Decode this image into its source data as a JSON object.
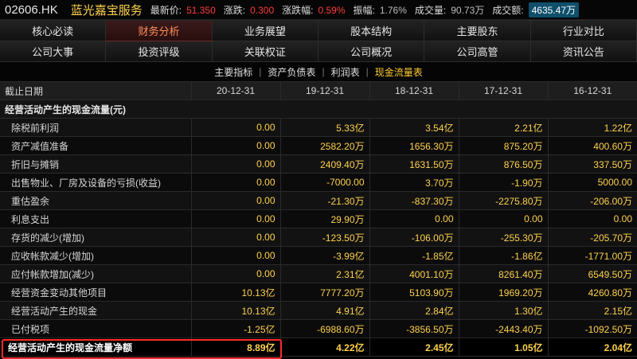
{
  "header": {
    "code": "02606.HK",
    "name": "蓝光嘉宝服务",
    "quotes": [
      {
        "label": "最新价:",
        "value": "51.350",
        "style": "red"
      },
      {
        "label": "涨跌:",
        "value": "0.300",
        "style": "red"
      },
      {
        "label": "涨跌幅:",
        "value": "0.59%",
        "style": "red"
      },
      {
        "label": "振幅:",
        "value": "1.76%",
        "style": "gray"
      },
      {
        "label": "成交量:",
        "value": "90.73万",
        "style": "gray"
      },
      {
        "label": "成交额:",
        "value": "4635.47万",
        "style": "badge"
      }
    ]
  },
  "tabs": {
    "row1": [
      "核心必读",
      "财务分析",
      "业务展望",
      "股本结构",
      "主要股东",
      "行业对比"
    ],
    "row2": [
      "公司大事",
      "投资评级",
      "关联权证",
      "公司概况",
      "公司高管",
      "资讯公告"
    ],
    "active": "财务分析"
  },
  "subtabs": {
    "items": [
      "主要指标",
      "资产负债表",
      "利润表",
      "现金流量表"
    ],
    "active": "现金流量表"
  },
  "table": {
    "header_first": "截止日期",
    "years": [
      "20-12-31",
      "19-12-31",
      "18-12-31",
      "17-12-31",
      "16-12-31"
    ],
    "section_title": "经营活动产生的现金流量(元)",
    "rows": [
      {
        "label": "除税前利润",
        "values": [
          "0.00",
          "5.33亿",
          "3.54亿",
          "2.21亿",
          "1.22亿"
        ]
      },
      {
        "label": "资产减值准备",
        "values": [
          "0.00",
          "2582.20万",
          "1656.30万",
          "875.20万",
          "400.60万"
        ]
      },
      {
        "label": "折旧与摊销",
        "values": [
          "0.00",
          "2409.40万",
          "1631.50万",
          "876.50万",
          "337.50万"
        ]
      },
      {
        "label": "出售物业、厂房及设备的亏损(收益)",
        "values": [
          "0.00",
          "-7000.00",
          "3.70万",
          "-1.90万",
          "5000.00"
        ]
      },
      {
        "label": "重估盈余",
        "values": [
          "0.00",
          "-21.30万",
          "-837.30万",
          "-2275.80万",
          "-206.00万"
        ]
      },
      {
        "label": "利息支出",
        "values": [
          "0.00",
          "29.90万",
          "0.00",
          "0.00",
          "0.00"
        ]
      },
      {
        "label": "存货的减少(增加)",
        "values": [
          "0.00",
          "-123.50万",
          "-106.00万",
          "-255.30万",
          "-205.70万"
        ]
      },
      {
        "label": "应收帐款减少(增加)",
        "values": [
          "0.00",
          "-3.99亿",
          "-1.85亿",
          "-1.86亿",
          "-1771.00万"
        ]
      },
      {
        "label": "应付帐款增加(减少)",
        "values": [
          "0.00",
          "2.31亿",
          "4001.10万",
          "8261.40万",
          "6549.50万"
        ]
      },
      {
        "label": "经营资金变动其他项目",
        "values": [
          "10.13亿",
          "7777.20万",
          "5103.90万",
          "1969.20万",
          "4260.80万"
        ]
      },
      {
        "label": "经营活动产生的现金",
        "values": [
          "10.13亿",
          "4.91亿",
          "2.84亿",
          "1.30亿",
          "2.15亿"
        ]
      },
      {
        "label": "已付税项",
        "values": [
          "-1.25亿",
          "-6988.60万",
          "-3856.50万",
          "-2443.40万",
          "-1092.50万"
        ]
      }
    ],
    "total": {
      "label": "经营活动产生的现金流量净额",
      "values": [
        "8.89亿",
        "4.22亿",
        "2.45亿",
        "1.05亿",
        "2.04亿"
      ]
    }
  }
}
